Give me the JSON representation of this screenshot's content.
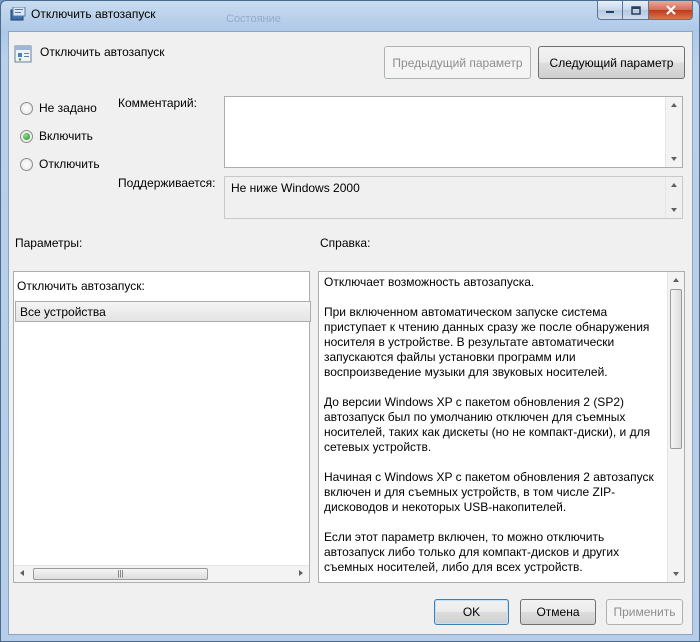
{
  "window": {
    "title": "Отключить автозапуск",
    "background_tab_text": "Состояние"
  },
  "header": {
    "policy_title": "Отключить автозапуск",
    "prev_button": "Предыдущий параметр",
    "next_button": "Следующий параметр"
  },
  "state": {
    "options": [
      {
        "label": "Не задано",
        "checked": false
      },
      {
        "label": "Включить",
        "checked": true
      },
      {
        "label": "Отключить",
        "checked": false
      }
    ]
  },
  "comment": {
    "label": "Комментарий:",
    "value": ""
  },
  "supported": {
    "label": "Поддерживается:",
    "value": "Не ниже Windows 2000"
  },
  "parameters": {
    "label": "Параметры:",
    "option_label": "Отключить автозапуск:",
    "selected_value": "Все устройства"
  },
  "help": {
    "label": "Справка:",
    "paragraphs": [
      "Отключает возможность автозапуска.",
      "При включенном автоматическом запуске система приступает к чтению данных сразу же после обнаружения носителя в устройстве. В результате автоматически запускаются файлы установки программ или воспроизведение музыки для звуковых носителей.",
      "До версии Windows XP с пакетом обновления 2 (SP2) автозапуск был по умолчанию отключен для съемных носителей, таких как дискеты (но не компакт-диски), и для сетевых устройств.",
      "Начиная с Windows XP с пакетом обновления 2 автозапуск включен и для съемных устройств, в том числе ZIP-дисководов и некоторых USB-накопителей.",
      "Если этот параметр включен, то можно отключить автозапуск либо только для компакт-дисков и других съемных носителей, либо для всех устройств."
    ]
  },
  "footer": {
    "ok": "OK",
    "cancel": "Отмена",
    "apply": "Применить"
  },
  "colors": {
    "accent": "#3c7fb1",
    "dialog_bg": "#f0f0f0",
    "title_bar": "#b5cde8"
  },
  "icons": {
    "window": "policy-window-icon",
    "header": "policy-settings-icon",
    "minimize": "minimize-icon",
    "maximize": "maximize-icon",
    "close": "close-icon"
  }
}
